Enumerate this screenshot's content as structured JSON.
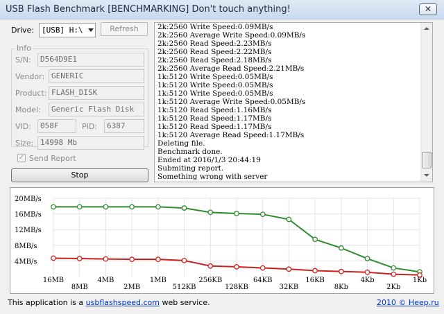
{
  "window": {
    "title": "USB Flash Benchmark [BENCHMARKING] Don't touch anything!",
    "close_glyph": "✕"
  },
  "drive": {
    "label": "Drive:",
    "value": "[USB] H:\\",
    "refresh_label": "Refresh"
  },
  "info": {
    "title": "Info",
    "sn_label": "S/N:",
    "sn": "D564D9E1",
    "vendor_label": "Vendor:",
    "vendor": "GENERIC",
    "product_label": "Product:",
    "product": "FLASH_DISK",
    "model_label": "Model:",
    "model": "Generic Flash Disk",
    "vid_label": "VID:",
    "vid": "058F",
    "pid_label": "PID:",
    "pid": "6387",
    "size_label": "Size:",
    "size": "14998 Mb"
  },
  "send_report": {
    "label": "Send Report",
    "checked": true,
    "check_glyph": "✓"
  },
  "stop_label": "Stop",
  "log": [
    "2k:2560 Write Speed:0.09MB/s",
    "2k:2560 Average Write Speed:0.09MB/s",
    "2k:2560 Read Speed:2.23MB/s",
    "2k:2560 Read Speed:2.22MB/s",
    "2k:2560 Read Speed:2.18MB/s",
    "2k:2560 Average Read Speed:2.21MB/s",
    "1k:5120 Write Speed:0.05MB/s",
    "1k:5120 Write Speed:0.05MB/s",
    "1k:5120 Write Speed:0.05MB/s",
    "1k:5120 Average Write Speed:0.05MB/s",
    "1k:5120 Read Speed:1.16MB/s",
    "1k:5120 Read Speed:1.17MB/s",
    "1k:5120 Read Speed:1.17MB/s",
    "1k:5120 Average Read Speed:1.17MB/s",
    "Deleting file.",
    "Benchmark done.",
    "Ended at 2016/1/3 20:44:19",
    "Submiting report.",
    "Something wrong with server"
  ],
  "chart_data": {
    "type": "line",
    "categories": [
      "16MB",
      "8MB",
      "4MB",
      "2MB",
      "1MB",
      "512KB",
      "256KB",
      "128KB",
      "64KB",
      "32KB",
      "16KB",
      "8Kb",
      "4Kb",
      "2Kb",
      "1Kb"
    ],
    "y_ticks": [
      "20MB/s",
      "16MB/s",
      "12MB/s",
      "8MB/s",
      "4MB/s"
    ],
    "ylim": [
      0,
      20
    ],
    "grid": true,
    "series": [
      {
        "values": [
          17.8,
          17.8,
          17.8,
          17.8,
          17.8,
          17.5,
          16.4,
          16.1,
          15.9,
          14.6,
          9.5,
          7.3,
          4.6,
          2.2,
          1.2
        ],
        "color": "#2e8b2e"
      },
      {
        "values": [
          4.7,
          4.6,
          4.5,
          4.4,
          4.4,
          4.1,
          2.7,
          2.5,
          2.2,
          1.9,
          1.5,
          1.3,
          1.1,
          0.6,
          0.4
        ],
        "color": "#cc2020"
      }
    ]
  },
  "footer": {
    "prefix": "This application is a ",
    "link": "usbflashspeed.com",
    "suffix": " web service.",
    "copyright": "2010 © Heep.ru"
  }
}
